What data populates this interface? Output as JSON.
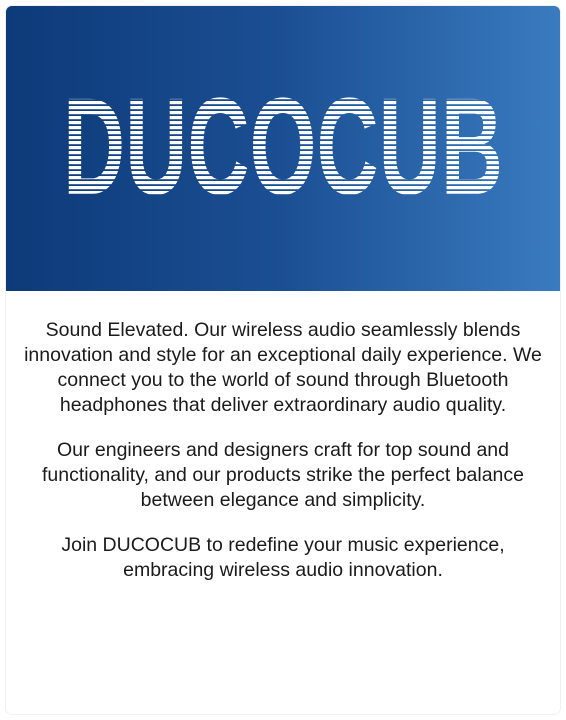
{
  "brand": {
    "logo_text": "DUCOCUB",
    "colors": {
      "banner_start": "#0d3a79",
      "banner_end": "#3a7bc0",
      "logo": "#ffffff"
    }
  },
  "description": {
    "paragraph_1": "Sound Elevated. Our wireless audio seamlessly blends innovation and style for an exceptional daily experience. We connect you to the world of sound through Bluetooth headphones that deliver extraordinary audio quality.",
    "paragraph_2": "Our engineers and designers craft for top sound and functionality, and our products strike the perfect balance between elegance and simplicity.",
    "paragraph_3": "Join DUCOCUB to redefine your music experience, embracing wireless audio innovation."
  }
}
